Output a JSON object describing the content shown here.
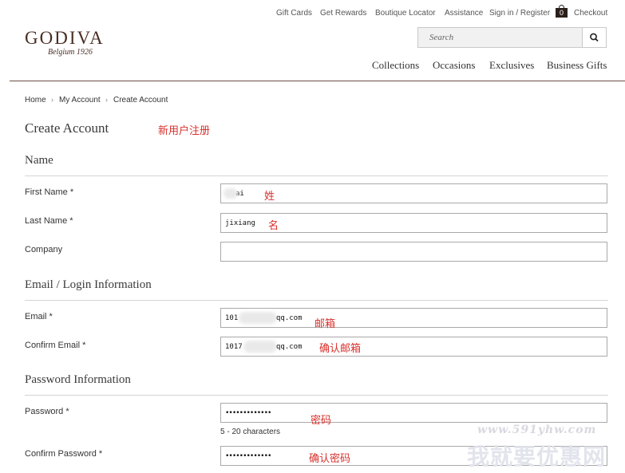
{
  "header": {
    "utility_links": [
      "Gift Cards",
      "Get Rewards",
      "Boutique Locator",
      "Assistance",
      "Sign in / Register"
    ],
    "cart_count": "0",
    "checkout_label": "Checkout",
    "logo_text": "GODIVA",
    "logo_sub": "Belgium 1926",
    "search_placeholder": "Search",
    "nav": [
      "Collections",
      "Occasions",
      "Exclusives",
      "Business Gifts"
    ]
  },
  "breadcrumb": [
    "Home",
    "My Account",
    "Create Account"
  ],
  "page_title": "Create Account",
  "annotations": {
    "title": "新用户注册",
    "first_name": "姓",
    "last_name": "名",
    "email": "邮箱",
    "confirm_email": "确认邮箱",
    "password": "密码",
    "confirm_password": "确认密码"
  },
  "sections": {
    "name": "Name",
    "email": "Email / Login Information",
    "password": "Password Information"
  },
  "fields": {
    "first_name": {
      "label": "First Name *",
      "value": "ai"
    },
    "last_name": {
      "label": "Last Name *",
      "value": "jixiang"
    },
    "company": {
      "label": "Company",
      "value": ""
    },
    "email": {
      "label": "Email *",
      "value_prefix": "101",
      "value_suffix": "qq.com"
    },
    "confirm_email": {
      "label": "Confirm Email *",
      "value_prefix": "1017",
      "value_suffix": "qq.com"
    },
    "password": {
      "label": "Password *",
      "value": "•••••••••••••",
      "hint": "5 - 20 characters"
    },
    "confirm_password": {
      "label": "Confirm Password *",
      "value": "•••••••••••••"
    }
  },
  "watermark": {
    "url": "www.591yhw.com",
    "text": "我就要优惠网"
  },
  "colors": {
    "brand_brown": "#4a2e24",
    "annotation_red": "#d9302c",
    "rule_gray": "#d4d4d4"
  }
}
